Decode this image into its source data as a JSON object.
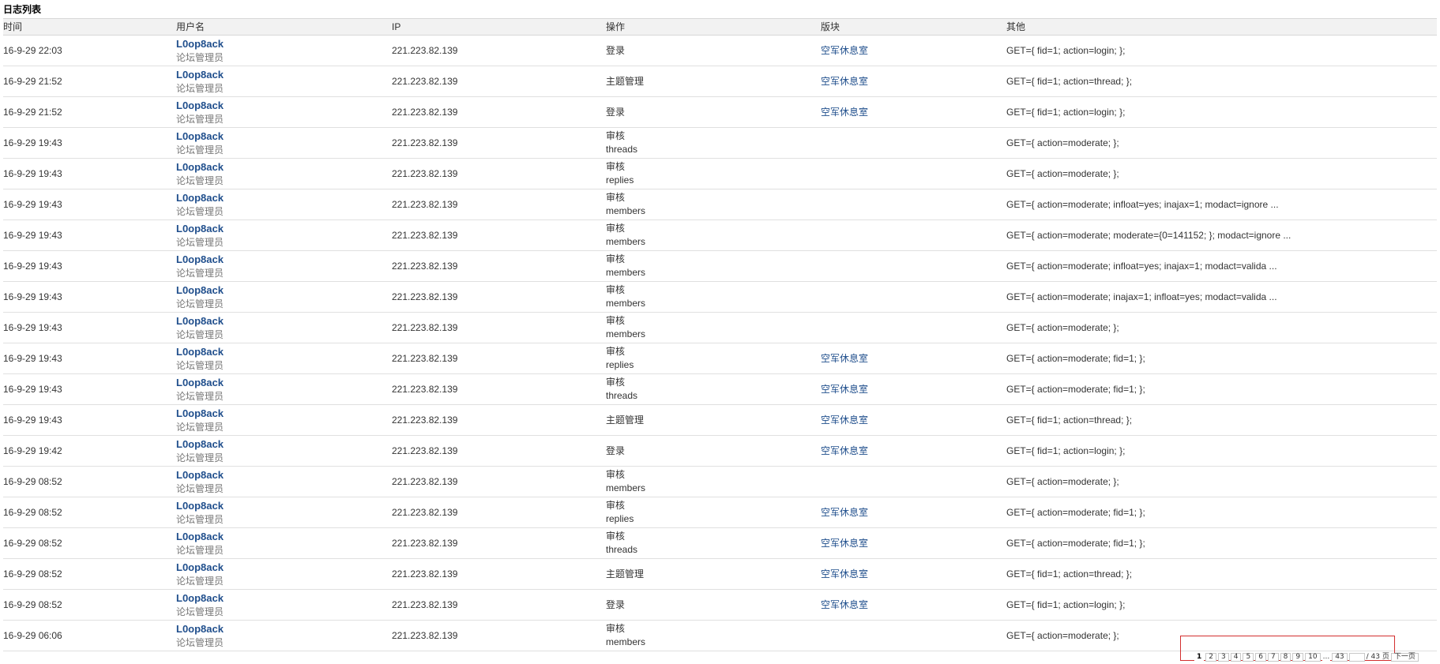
{
  "page": {
    "title": "日志列表"
  },
  "table": {
    "headers": [
      "时间",
      "用户名",
      "IP",
      "操作",
      "版块",
      "其他"
    ],
    "rows": [
      {
        "time": "16-9-29 22:03",
        "user": "L0op8ack",
        "role": "论坛管理员",
        "ip": "221.223.82.139",
        "op": "登录",
        "op_sub": "",
        "forum": "空军休息室",
        "other": "GET={ fid=1; action=login; };"
      },
      {
        "time": "16-9-29 21:52",
        "user": "L0op8ack",
        "role": "论坛管理员",
        "ip": "221.223.82.139",
        "op": "主题管理",
        "op_sub": "",
        "forum": "空军休息室",
        "other": "GET={ fid=1; action=thread; };"
      },
      {
        "time": "16-9-29 21:52",
        "user": "L0op8ack",
        "role": "论坛管理员",
        "ip": "221.223.82.139",
        "op": "登录",
        "op_sub": "",
        "forum": "空军休息室",
        "other": "GET={ fid=1; action=login; };"
      },
      {
        "time": "16-9-29 19:43",
        "user": "L0op8ack",
        "role": "论坛管理员",
        "ip": "221.223.82.139",
        "op": "审核",
        "op_sub": "threads",
        "forum": "",
        "other": "GET={ action=moderate; };"
      },
      {
        "time": "16-9-29 19:43",
        "user": "L0op8ack",
        "role": "论坛管理员",
        "ip": "221.223.82.139",
        "op": "审核",
        "op_sub": "replies",
        "forum": "",
        "other": "GET={ action=moderate; };"
      },
      {
        "time": "16-9-29 19:43",
        "user": "L0op8ack",
        "role": "论坛管理员",
        "ip": "221.223.82.139",
        "op": "审核",
        "op_sub": "members",
        "forum": "",
        "other": "GET={ action=moderate; infloat=yes; inajax=1; modact=ignore ..."
      },
      {
        "time": "16-9-29 19:43",
        "user": "L0op8ack",
        "role": "论坛管理员",
        "ip": "221.223.82.139",
        "op": "审核",
        "op_sub": "members",
        "forum": "",
        "other": "GET={ action=moderate; moderate={0=141152; }; modact=ignore ..."
      },
      {
        "time": "16-9-29 19:43",
        "user": "L0op8ack",
        "role": "论坛管理员",
        "ip": "221.223.82.139",
        "op": "审核",
        "op_sub": "members",
        "forum": "",
        "other": "GET={ action=moderate; infloat=yes; inajax=1; modact=valida ..."
      },
      {
        "time": "16-9-29 19:43",
        "user": "L0op8ack",
        "role": "论坛管理员",
        "ip": "221.223.82.139",
        "op": "审核",
        "op_sub": "members",
        "forum": "",
        "other": "GET={ action=moderate; inajax=1; infloat=yes; modact=valida ..."
      },
      {
        "time": "16-9-29 19:43",
        "user": "L0op8ack",
        "role": "论坛管理员",
        "ip": "221.223.82.139",
        "op": "审核",
        "op_sub": "members",
        "forum": "",
        "other": "GET={ action=moderate; };"
      },
      {
        "time": "16-9-29 19:43",
        "user": "L0op8ack",
        "role": "论坛管理员",
        "ip": "221.223.82.139",
        "op": "审核",
        "op_sub": "replies",
        "forum": "空军休息室",
        "other": "GET={ action=moderate; fid=1; };"
      },
      {
        "time": "16-9-29 19:43",
        "user": "L0op8ack",
        "role": "论坛管理员",
        "ip": "221.223.82.139",
        "op": "审核",
        "op_sub": "threads",
        "forum": "空军休息室",
        "other": "GET={ action=moderate; fid=1; };"
      },
      {
        "time": "16-9-29 19:43",
        "user": "L0op8ack",
        "role": "论坛管理员",
        "ip": "221.223.82.139",
        "op": "主题管理",
        "op_sub": "",
        "forum": "空军休息室",
        "other": "GET={ fid=1; action=thread; };"
      },
      {
        "time": "16-9-29 19:42",
        "user": "L0op8ack",
        "role": "论坛管理员",
        "ip": "221.223.82.139",
        "op": "登录",
        "op_sub": "",
        "forum": "空军休息室",
        "other": "GET={ fid=1; action=login; };"
      },
      {
        "time": "16-9-29 08:52",
        "user": "L0op8ack",
        "role": "论坛管理员",
        "ip": "221.223.82.139",
        "op": "审核",
        "op_sub": "members",
        "forum": "",
        "other": "GET={ action=moderate; };"
      },
      {
        "time": "16-9-29 08:52",
        "user": "L0op8ack",
        "role": "论坛管理员",
        "ip": "221.223.82.139",
        "op": "审核",
        "op_sub": "replies",
        "forum": "空军休息室",
        "other": "GET={ action=moderate; fid=1; };"
      },
      {
        "time": "16-9-29 08:52",
        "user": "L0op8ack",
        "role": "论坛管理员",
        "ip": "221.223.82.139",
        "op": "审核",
        "op_sub": "threads",
        "forum": "空军休息室",
        "other": "GET={ action=moderate; fid=1; };"
      },
      {
        "time": "16-9-29 08:52",
        "user": "L0op8ack",
        "role": "论坛管理员",
        "ip": "221.223.82.139",
        "op": "主题管理",
        "op_sub": "",
        "forum": "空军休息室",
        "other": "GET={ fid=1; action=thread; };"
      },
      {
        "time": "16-9-29 08:52",
        "user": "L0op8ack",
        "role": "论坛管理员",
        "ip": "221.223.82.139",
        "op": "登录",
        "op_sub": "",
        "forum": "空军休息室",
        "other": "GET={ fid=1; action=login; };"
      },
      {
        "time": "16-9-29 06:06",
        "user": "L0op8ack",
        "role": "论坛管理员",
        "ip": "221.223.82.139",
        "op": "审核",
        "op_sub": "members",
        "forum": "",
        "other": "GET={ action=moderate; };"
      }
    ]
  },
  "pager": {
    "current": "1",
    "pages": [
      "2",
      "3",
      "4",
      "5",
      "6",
      "7",
      "8",
      "9",
      "10"
    ],
    "ellipsis": "...",
    "last": "43",
    "input_value": "",
    "total": "/ 43 页",
    "next": "下一页",
    "highlight_color": "#d32f2f"
  }
}
